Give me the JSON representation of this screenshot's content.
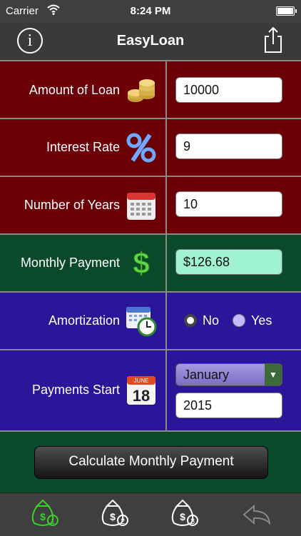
{
  "status_bar": {
    "carrier": "Carrier",
    "time": "8:24 PM"
  },
  "nav": {
    "title": "EasyLoan",
    "info_glyph": "i"
  },
  "form": {
    "amount": {
      "label": "Amount of Loan",
      "value": "10000",
      "icon": "coins-icon"
    },
    "interest": {
      "label": "Interest Rate",
      "value": "9",
      "icon": "percent-icon"
    },
    "years": {
      "label": "Number of Years",
      "value": "10",
      "icon": "calendar-grid-icon"
    },
    "monthly": {
      "label": "Monthly Payment",
      "value": "$126.68",
      "icon": "dollar-icon"
    },
    "amortization": {
      "label": "Amortization",
      "options": [
        "No",
        "Yes"
      ],
      "selected": "No",
      "icon": "calendar-clock-icon"
    },
    "start": {
      "label": "Payments Start",
      "month": "January",
      "year": "2015",
      "icon": "calendar-date-icon",
      "icon_month": "JUNE",
      "icon_day": "18"
    }
  },
  "calculate_button": "Calculate Monthly Payment",
  "tabs": [
    {
      "name": "money-bag-1",
      "badge": "1",
      "active": true
    },
    {
      "name": "money-bag-2",
      "badge": "2",
      "active": false
    },
    {
      "name": "money-bag-3",
      "badge": "3",
      "active": false
    },
    {
      "name": "back-arrow",
      "active": false
    }
  ],
  "colors": {
    "red_row": "#6b0006",
    "green_row": "#0a4a2a",
    "blue_row": "#2b1599",
    "active_tab": "#39d22a"
  }
}
